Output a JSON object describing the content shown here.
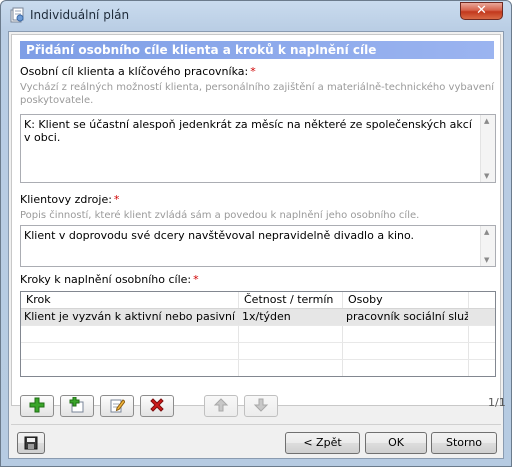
{
  "window": {
    "title": "Individuální plán",
    "close_symbol": "✕",
    "icon": "plan-document-icon"
  },
  "section": {
    "header": "Přidání osobního cíle klienta a kroků k naplnění cíle"
  },
  "goal": {
    "label": "Osobní cíl klienta a klíčového pracovníka:",
    "required_mark": "*",
    "hint_line1": "Vychází z reálných možností klienta, personálního zajištění a materiálně-technického vybavení",
    "hint_line2": "poskytovatele.",
    "value": "K: Klient se účastní alespoň jedenkrát za měsíc na některé ze společenských akcí v obci."
  },
  "resources": {
    "label": "Klientovy zdroje:",
    "required_mark": "*",
    "hint": "Popis činností, které klient zvládá sám a povedou k naplnění jeho osobního cíle.",
    "value": "Klient v doprovodu své dcery navštěvoval nepravidelně divadlo a kino."
  },
  "steps": {
    "label": "Kroky k naplnění osobního cíle:",
    "required_mark": "*",
    "columns": [
      "Krok",
      "Četnost / termín",
      "Osoby"
    ],
    "rows": [
      [
        "Klient je vyzván k aktivní nebo pasivní úča...",
        "1x/týden",
        "pracovník sociální služby"
      ]
    ]
  },
  "toolbar": {
    "icons": [
      "add-icon",
      "add-subitem-icon",
      "edit-icon",
      "delete-icon",
      "move-up-icon",
      "move-down-icon"
    ],
    "pager": "1/1"
  },
  "footer": {
    "save_icon": "floppy-disk-icon",
    "back_label": "< Zpět",
    "ok_label": "OK",
    "cancel_label": "Storno"
  },
  "colors": {
    "header_bg": "#8aa8ea",
    "required": "#d00000",
    "add_green": "#3aa52a",
    "delete_red": "#d01a1a"
  }
}
